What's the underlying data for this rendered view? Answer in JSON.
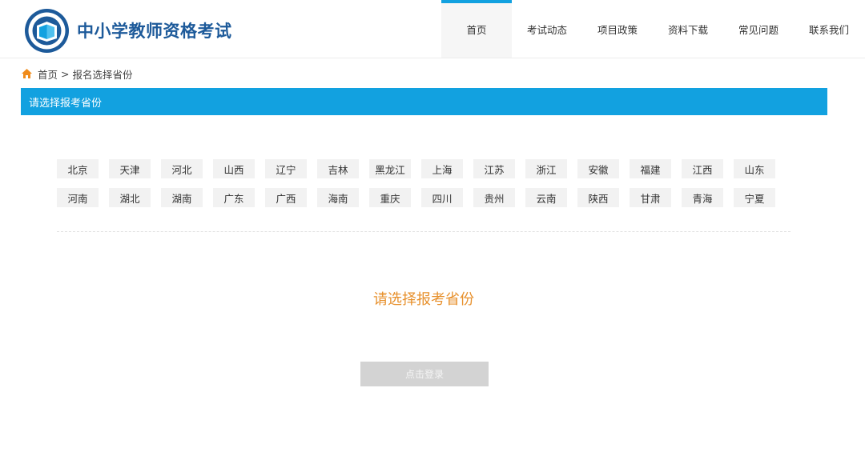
{
  "header": {
    "site_title": "中小学教师资格考试",
    "nav": [
      {
        "label": "首页",
        "active": true
      },
      {
        "label": "考试动态",
        "active": false
      },
      {
        "label": "项目政策",
        "active": false
      },
      {
        "label": "资料下载",
        "active": false
      },
      {
        "label": "常见问题",
        "active": false
      },
      {
        "label": "联系我们",
        "active": false
      }
    ]
  },
  "breadcrumb": {
    "home": "首页",
    "separator": ">",
    "current": "报名选择省份"
  },
  "section": {
    "title": "请选择报考省份"
  },
  "provinces": {
    "row1": [
      "北京",
      "天津",
      "河北",
      "山西",
      "辽宁",
      "吉林",
      "黑龙江",
      "上海",
      "江苏",
      "浙江",
      "安徽",
      "福建",
      "江西",
      "山东"
    ],
    "row2": [
      "河南",
      "湖北",
      "湖南",
      "广东",
      "广西",
      "海南",
      "重庆",
      "四川",
      "贵州",
      "云南",
      "陕西",
      "甘肃",
      "青海",
      "宁夏"
    ]
  },
  "prompt": "请选择报考省份",
  "login_button": "点击登录",
  "colors": {
    "accent": "#12a1e0",
    "title_blue": "#1d5a9a",
    "prompt_orange": "#e7902c",
    "home_icon": "#f08c1c",
    "disabled_button": "#d3d3d3"
  }
}
